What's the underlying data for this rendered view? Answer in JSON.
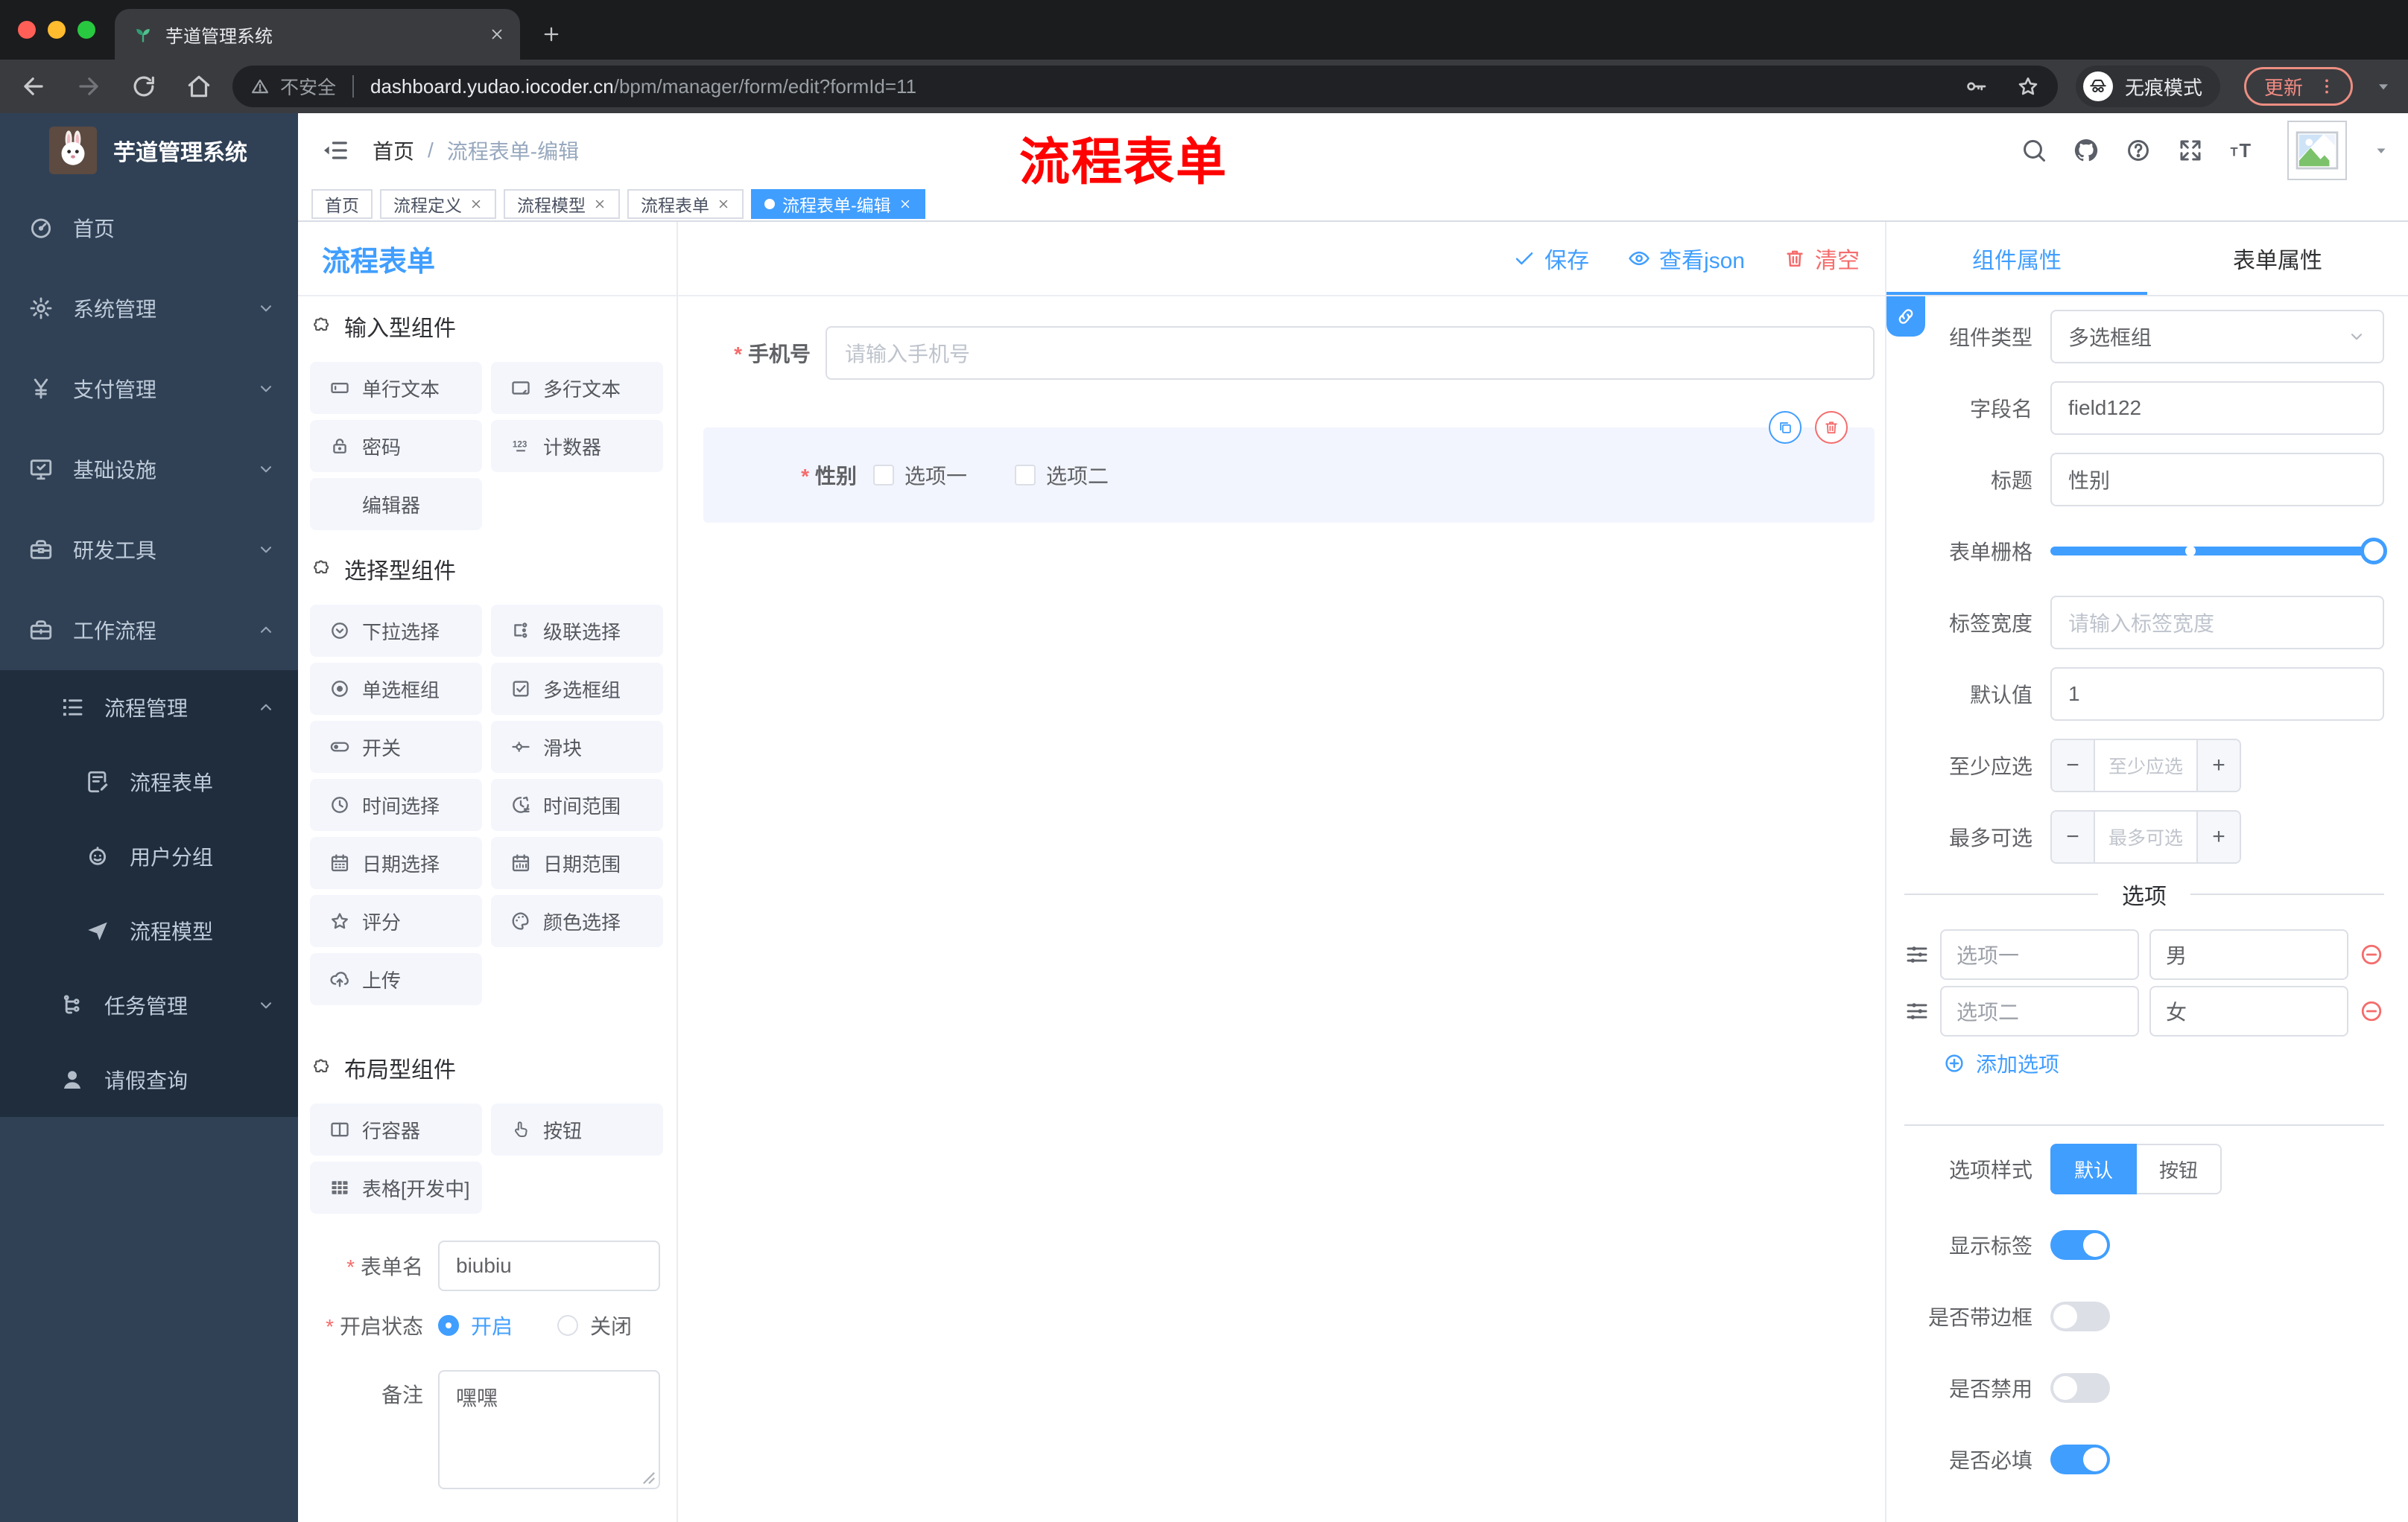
{
  "colors": {
    "accent": "#409eff",
    "danger": "#f56c6c",
    "overlay_red": "#fe0100",
    "sidebar_bg": "#304156",
    "sidebar_sub_bg": "#1f2d3d",
    "active_tag": "#409eff"
  },
  "browser": {
    "tab_title": "芋道管理系统",
    "security_label": "不安全",
    "url_domain": "dashboard.yudao.iocoder.cn",
    "url_path": "/bpm/manager/form/edit?formId=11",
    "incognito_label": "无痕模式",
    "update_label": "更新"
  },
  "sidebar": {
    "logo_title": "芋道管理系统",
    "items": [
      {
        "key": "home",
        "icon": "dashboard-icon",
        "label": "首页",
        "level": 0,
        "arrow": null,
        "dark": false
      },
      {
        "key": "system",
        "icon": "gear-icon",
        "label": "系统管理",
        "level": 0,
        "arrow": "down",
        "dark": false
      },
      {
        "key": "payment",
        "icon": "yen-icon",
        "label": "支付管理",
        "level": 0,
        "arrow": "down",
        "dark": false
      },
      {
        "key": "infra",
        "icon": "monitor-icon",
        "label": "基础设施",
        "level": 0,
        "arrow": "down",
        "dark": false
      },
      {
        "key": "devtools",
        "icon": "toolbox-icon",
        "label": "研发工具",
        "level": 0,
        "arrow": "down",
        "dark": false
      },
      {
        "key": "workflow",
        "icon": "briefcase-icon",
        "label": "工作流程",
        "level": 0,
        "arrow": "up",
        "dark": false
      },
      {
        "key": "process-mgmt",
        "icon": "list-icon",
        "label": "流程管理",
        "level": 1,
        "arrow": "up",
        "dark": true
      },
      {
        "key": "process-form",
        "icon": "doc-edit-icon",
        "label": "流程表单",
        "level": 2,
        "arrow": null,
        "dark": true
      },
      {
        "key": "user-group",
        "icon": "robot-icon",
        "label": "用户分组",
        "level": 2,
        "arrow": null,
        "dark": true
      },
      {
        "key": "process-model",
        "icon": "plane-icon",
        "label": "流程模型",
        "level": 2,
        "arrow": null,
        "dark": true
      },
      {
        "key": "task-mgmt",
        "icon": "tree-icon",
        "label": "任务管理",
        "level": 1,
        "arrow": "down",
        "dark": true
      },
      {
        "key": "leave-query",
        "icon": "user-icon",
        "label": "请假查询",
        "level": 1,
        "arrow": null,
        "dark": true
      }
    ]
  },
  "navbar": {
    "breadcrumb_root": "首页",
    "breadcrumb_sep": "/",
    "breadcrumb_current": "流程表单-编辑",
    "overlay_text": "流程表单"
  },
  "tags": [
    {
      "label": "首页",
      "closable": false,
      "active": false
    },
    {
      "label": "流程定义",
      "closable": true,
      "active": false
    },
    {
      "label": "流程模型",
      "closable": true,
      "active": false
    },
    {
      "label": "流程表单",
      "closable": true,
      "active": false
    },
    {
      "label": "流程表单-编辑",
      "closable": true,
      "active": true
    }
  ],
  "palette": {
    "title": "流程表单",
    "sections": [
      {
        "title": "输入型组件",
        "items": [
          {
            "key": "single-text",
            "icon": "input-icon",
            "label": "单行文本"
          },
          {
            "key": "multi-text",
            "icon": "textarea-icon",
            "label": "多行文本"
          },
          {
            "key": "password",
            "icon": "lock-icon",
            "label": "密码"
          },
          {
            "key": "counter",
            "icon": "counter-icon",
            "label": "计数器"
          },
          {
            "key": "editor",
            "icon": null,
            "label": "编辑器"
          }
        ]
      },
      {
        "title": "选择型组件",
        "items": [
          {
            "key": "select",
            "icon": "select-icon",
            "label": "下拉选择"
          },
          {
            "key": "cascader",
            "icon": "cascader-icon",
            "label": "级联选择"
          },
          {
            "key": "radio-group",
            "icon": "radio-icon",
            "label": "单选框组"
          },
          {
            "key": "checkbox-group",
            "icon": "checkbox-icon",
            "label": "多选框组"
          },
          {
            "key": "switch",
            "icon": "switch-icon",
            "label": "开关"
          },
          {
            "key": "slider",
            "icon": "slider-icon",
            "label": "滑块"
          },
          {
            "key": "time-picker",
            "icon": "time-icon",
            "label": "时间选择"
          },
          {
            "key": "time-range",
            "icon": "time-range-icon",
            "label": "时间范围"
          },
          {
            "key": "date-picker",
            "icon": "date-icon",
            "label": "日期选择"
          },
          {
            "key": "date-range",
            "icon": "date-range-icon",
            "label": "日期范围"
          },
          {
            "key": "rate",
            "icon": "star-icon",
            "label": "评分"
          },
          {
            "key": "color-picker",
            "icon": "palette-icon",
            "label": "颜色选择"
          },
          {
            "key": "upload",
            "icon": "upload-icon",
            "label": "上传"
          }
        ]
      },
      {
        "title": "布局型组件",
        "items": [
          {
            "key": "row-container",
            "icon": "columns-icon",
            "label": "行容器"
          },
          {
            "key": "button",
            "icon": "pointer-icon",
            "label": "按钮"
          },
          {
            "key": "table",
            "icon": "table-icon",
            "label": "表格[开发中]"
          }
        ]
      }
    ],
    "form": {
      "name_label": "表单名",
      "name_value": "biubiu",
      "status_label": "开启状态",
      "status_options": [
        "开启",
        "关闭"
      ],
      "status_selected": "开启",
      "remark_label": "备注",
      "remark_value": "嘿嘿"
    }
  },
  "canvas": {
    "save": "保存",
    "view_json": "查看json",
    "clear": "清空",
    "fields": {
      "phone_label": "手机号",
      "phone_placeholder": "请输入手机号",
      "gender_label": "性别",
      "gender_options": [
        "选项一",
        "选项二"
      ]
    }
  },
  "panel": {
    "tab_component": "组件属性",
    "tab_form": "表单属性",
    "component_type_label": "组件类型",
    "component_type_value": "多选框组",
    "field_name_label": "字段名",
    "field_name_value": "field122",
    "title_label": "标题",
    "title_value": "性别",
    "grid_label": "表单栅格",
    "label_width_label": "标签宽度",
    "label_width_placeholder": "请输入标签宽度",
    "default_label": "默认值",
    "default_value": "1",
    "min_label": "至少应选",
    "min_placeholder": "至少应选",
    "max_label": "最多可选",
    "max_placeholder": "最多可选",
    "options_divider": "选项",
    "options": [
      {
        "label": "选项一",
        "value": "男"
      },
      {
        "label": "选项二",
        "value": "女"
      }
    ],
    "add_option": "添加选项",
    "style_label": "选项样式",
    "style_options": [
      "默认",
      "按钮"
    ],
    "style_selected": "默认",
    "switches": [
      {
        "label": "显示标签",
        "on": true
      },
      {
        "label": "是否带边框",
        "on": false
      },
      {
        "label": "是否禁用",
        "on": false
      },
      {
        "label": "是否必填",
        "on": true
      }
    ]
  }
}
